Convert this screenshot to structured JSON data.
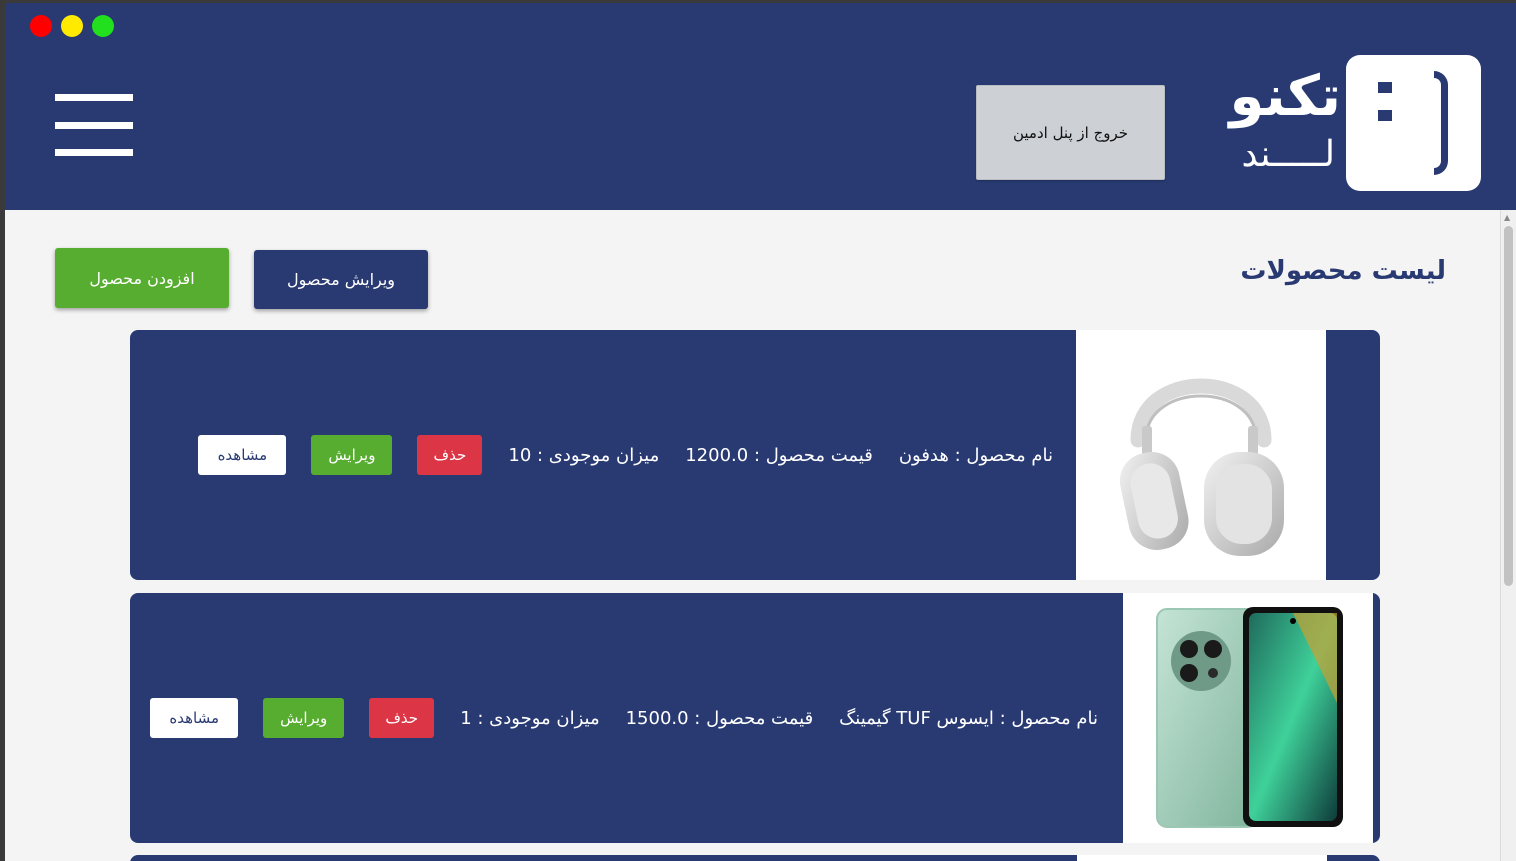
{
  "window": {
    "controls": [
      {
        "name": "close",
        "color": "#ff0000"
      },
      {
        "name": "minimize",
        "color": "#ffea00"
      },
      {
        "name": "maximize",
        "color": "#22e01e"
      }
    ]
  },
  "header": {
    "logo_title": "تکنو",
    "logo_sub": "لـــــند",
    "exit_button": "خروج از پنل ادمین",
    "menu_icon": "hamburger-icon"
  },
  "main": {
    "title": "لیست محصولات",
    "edit_product_button": "ویرایش محصول",
    "add_product_button": "افزودن محصول"
  },
  "products": [
    {
      "name": "نام محصول : هدفون",
      "price": "قیمت محصول : 1200.0",
      "stock": "میزان موجودی : 10",
      "image": "headphones-image",
      "delete_label": "حذف",
      "edit_label": "ویرایش",
      "view_label": "مشاهده"
    },
    {
      "name": "نام محصول : ایسوس TUF گیمینگ",
      "price": "قیمت محصول : 1500.0",
      "stock": "میزان موجودی : 1",
      "image": "smartphone-image",
      "delete_label": "حذف",
      "edit_label": "ویرایش",
      "view_label": "مشاهده"
    }
  ],
  "colors": {
    "primary": "#293a73",
    "success": "#57ad30",
    "danger": "#dc3545",
    "background": "#f4f4f4"
  }
}
